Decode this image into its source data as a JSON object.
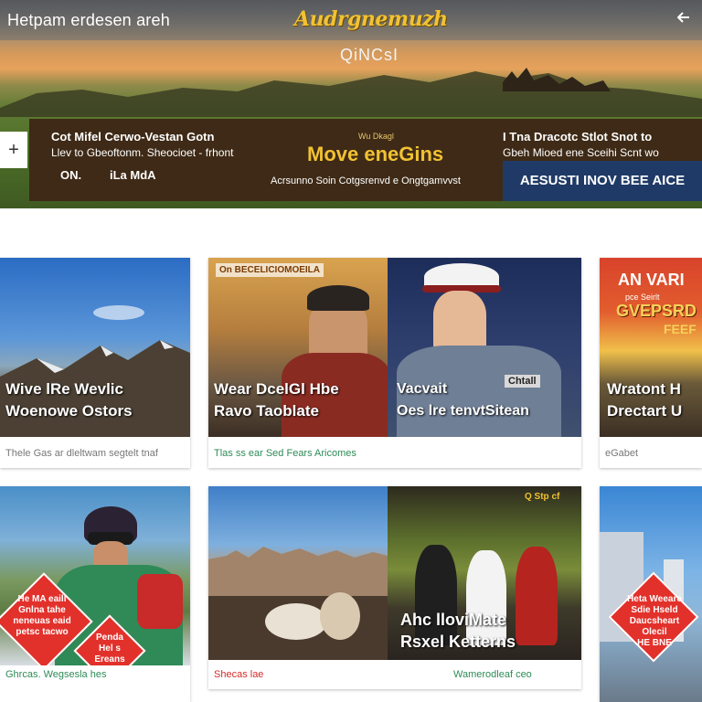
{
  "topbar": {
    "site_title": "Hetpam erdesen areh",
    "logo_text": "Audrgnemuzh",
    "back_icon": "back-arrow-icon"
  },
  "hero": {
    "subtitle": "QiNCsI",
    "plus_icon": "plus-icon"
  },
  "banner": {
    "left": {
      "line1": "Cot Mifel Cerwo-Vestan Gotn",
      "line2": "Llev to Gbeoftonm. Sheocioet - frhont",
      "btn1": "ON.",
      "btn2": "iLa MdA"
    },
    "center": {
      "small": "Wu Dkagl",
      "title": "Move eneGins",
      "subtitle": "Acrsunno Soin Cotgsrenvd e Ongtgamvvst"
    },
    "right": {
      "line1": "I Tna Dracotc Stlot Snot to",
      "line2": "Gbeh Mioed ene Sceihi Scnt wo",
      "button": "AESUSTI INOV BEE AICE"
    }
  },
  "cards": [
    {
      "overlay": [
        "Wive lRe Wevlic",
        "Woenowe Ostors"
      ],
      "caption": "Thele Gas ar dleltwam segtelt tnaf"
    },
    {
      "tag": "On BECELICIOMOEILA",
      "overlay_left": [
        "Wear DcelGl Hbe",
        "Ravo Taoblate"
      ],
      "overlay_right": [
        "Vacvait",
        "Oes lre tenvtSitean"
      ],
      "overlay_right_badge": "Chtall",
      "caption": "Tlas ss ear Sed Fears Aricomes"
    },
    {
      "overlay": [
        "AN VARI",
        "pce Seirlt",
        "GVEPSRD",
        "FEEF",
        "Wratont H",
        "Drectart U"
      ],
      "caption": "eGabet"
    },
    {
      "heart1": [
        "He MA eaill",
        "Gnlna tahe",
        "neneuas eaid",
        "petsc tacwo"
      ],
      "heart2": [
        "Penda",
        "Hel s",
        "Ereans"
      ],
      "caption": "Ghrcas. Wegsesla hes"
    },
    {
      "overlay": [
        "Ahc lloviMate",
        "Rsxel Ketterns"
      ],
      "tag": "Q Stp cf",
      "caption_red": "Shecas lae",
      "caption_green": "Wamerodleaf ceo"
    },
    {
      "heart": [
        "Heta Weeare",
        "Sdie Hseld",
        "Daucsheart",
        "Olecil",
        "HE BNE"
      ]
    }
  ],
  "colors": {
    "accent_gold": "#f1c232",
    "banner_bg": "#3e2a16",
    "banner_button": "#1f3a66",
    "heart_red": "#e2312b",
    "caption_green": "#2e8b57",
    "caption_red": "#d42a2a"
  }
}
